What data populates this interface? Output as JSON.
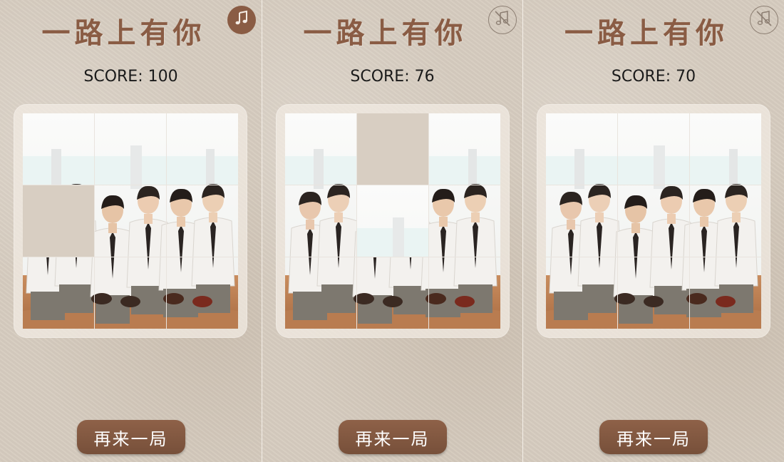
{
  "colors": {
    "background": "#d6ccbf",
    "title": "#8a5c44",
    "button": "#7f563f",
    "board": "#f1ebe3",
    "empty_tile": "#d8cec2"
  },
  "panels": [
    {
      "title": "一路上有你",
      "music_icon": "music-note-icon",
      "music_state": "on",
      "score_text": "SCORE: 100",
      "restart_label": "再来一局",
      "tiles": [
        1,
        2,
        3,
        0,
        5,
        6,
        7,
        8,
        9
      ]
    },
    {
      "title": "一路上有你",
      "music_icon": "music-muted-icon",
      "music_state": "off",
      "score_text": "SCORE: 76",
      "restart_label": "再来一局",
      "tiles": [
        1,
        0,
        3,
        4,
        2,
        6,
        7,
        8,
        9
      ]
    },
    {
      "title": "一路上有你",
      "music_icon": "music-muted-icon",
      "music_state": "off",
      "score_text": "SCORE: 70",
      "restart_label": "再来一局",
      "tiles": [
        1,
        2,
        3,
        4,
        5,
        6,
        7,
        8,
        9
      ]
    }
  ],
  "tile_empty_value": 0
}
